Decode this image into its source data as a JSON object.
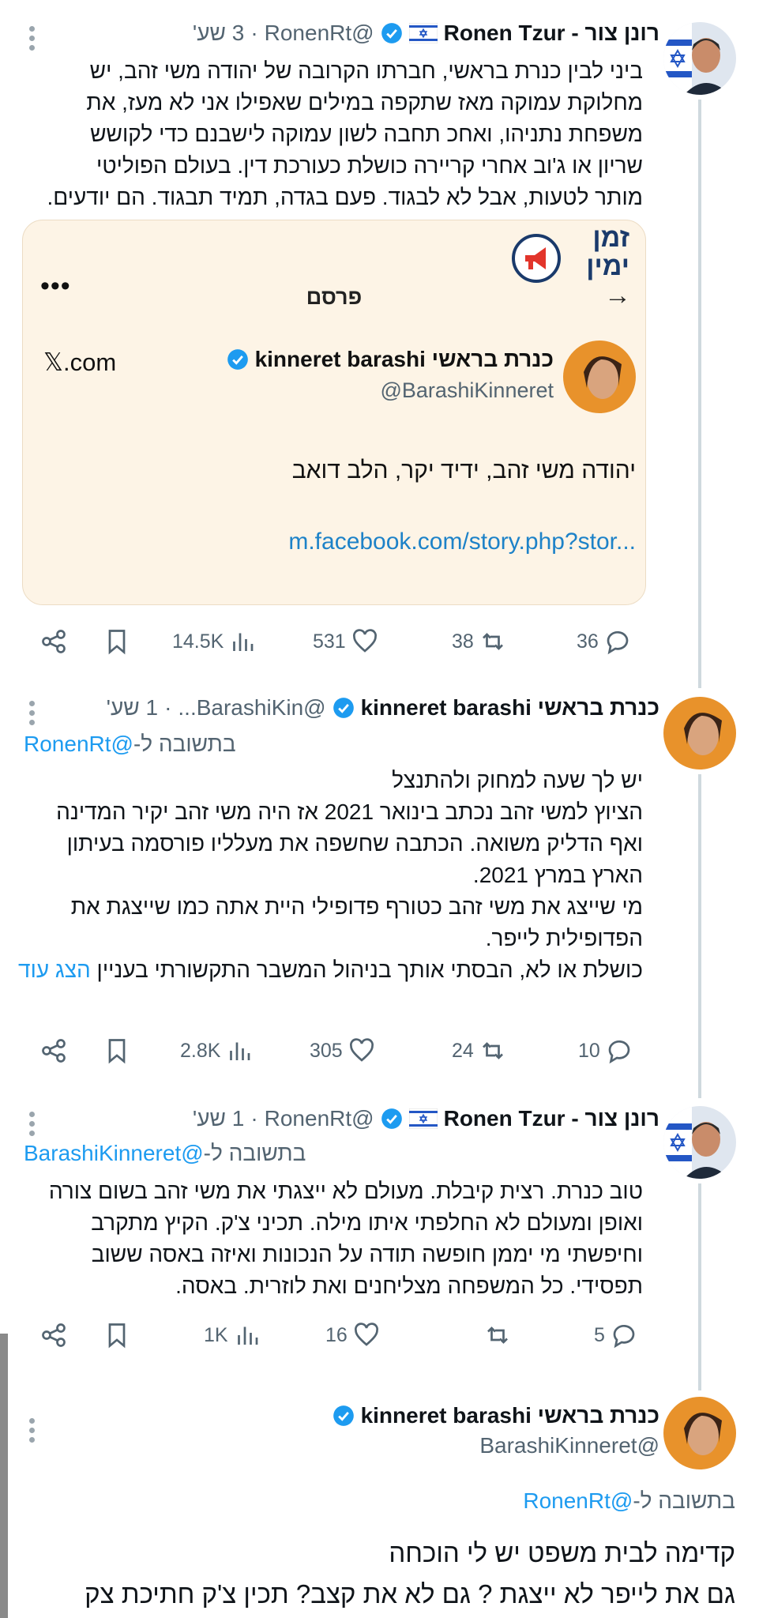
{
  "tweets": [
    {
      "name": "רונן צור - Ronen Tzur",
      "handle": "@RonenRt",
      "time": "3 שע'",
      "text": [
        "ביני לבין כנרת בראשי, חברתו הקרובה של יהודה משי זהב, יש",
        "מחלוקת עמוקה מאז שתקפה במילים שאפילו אני לא מעז, את",
        "משפחת נתניהו, ואחכ תחבה לשון עמוקה לישבנם כדי לקושש",
        "שריון או ג'וב אחרי קריירה כושלת כעורכת דין. בעולם הפוליטי",
        "מותר לטעות, אבל לא לבגוד. פעם בגדה, תמיד תבגוד. הם יודעים."
      ],
      "stats": {
        "replies": "36",
        "reposts": "38",
        "likes": "531",
        "views": "14.5K"
      }
    },
    {
      "name": "כנרת בראשי kinneret barashi",
      "handle": "@BarashiKin...",
      "time": "1 שע'",
      "reply_label": "בתשובה ל-",
      "reply_handle": "@RonenRt",
      "text": [
        "יש לך שעה למחוק ולהתנצל",
        "הציוץ למשי זהב נכתב בינואר 2021 אז היה משי זהב יקיר המדינה",
        "ואף הדליק משואה. הכתבה שחשפה את מעלליו פורסמה בעיתון",
        "הארץ במרץ 2021.",
        "מי שייצג את משי זהב כטורף פדופילי  היית אתה כמו שייצגת את",
        "הפדופילית לייפר.",
        "כושלת או לא, הבסתי אותך בניהול המשבר התקשורתי בעניין"
      ],
      "show_more": "הצג עוד",
      "stats": {
        "replies": "10",
        "reposts": "24",
        "likes": "305",
        "views": "2.8K"
      }
    },
    {
      "name": "רונן צור - Ronen Tzur",
      "handle": "@RonenRt",
      "time": "1 שע'",
      "reply_label": "בתשובה ל-",
      "reply_handle": "@BarashiKinneret",
      "text": [
        "טוב כנרת. רצית קיבלת. מעולם לא ייצגתי את משי זהב בשום צורה",
        "ואופן ומעולם לא החלפתי איתו מילה. תכיני צ'ק. הקיץ מתקרב",
        "וחיפשתי מי יממן חופשה תודה על הנכונות ואיזה באסה ששוב",
        "תפסידי. כל המשפחה מצליחנים ואת לוזרית. באסה."
      ],
      "stats": {
        "replies": "5",
        "reposts": "",
        "likes": "16",
        "views": "1K"
      }
    },
    {
      "name": "כנרת בראשי kinneret barashi",
      "handle": "@BarashiKinneret",
      "reply_label": "בתשובה ל-",
      "reply_handle": "@RonenRt",
      "text": [
        "קדימה לבית משפט יש לי הוכחה",
        "גם את לייפר לא ייצגת ? גם לא את קצב? תכין צ'ק חתיכת צק"
      ]
    }
  ],
  "card": {
    "logo_text": "זמן ימין",
    "title": "פרסם",
    "menu": "•••",
    "arrow": "→",
    "domain": "𝕏.com",
    "name": "כנרת בראשי kinneret barashi",
    "handle": "@BarashiKinneret",
    "body": "יהודה משי זהב, ידיד יקר, הלב דואב",
    "link": "m.facebook.com/story.php?stor..."
  },
  "colors": {
    "accent": "#1d9bf0",
    "muted": "#536471",
    "card_bg": "#fdf4e6"
  }
}
